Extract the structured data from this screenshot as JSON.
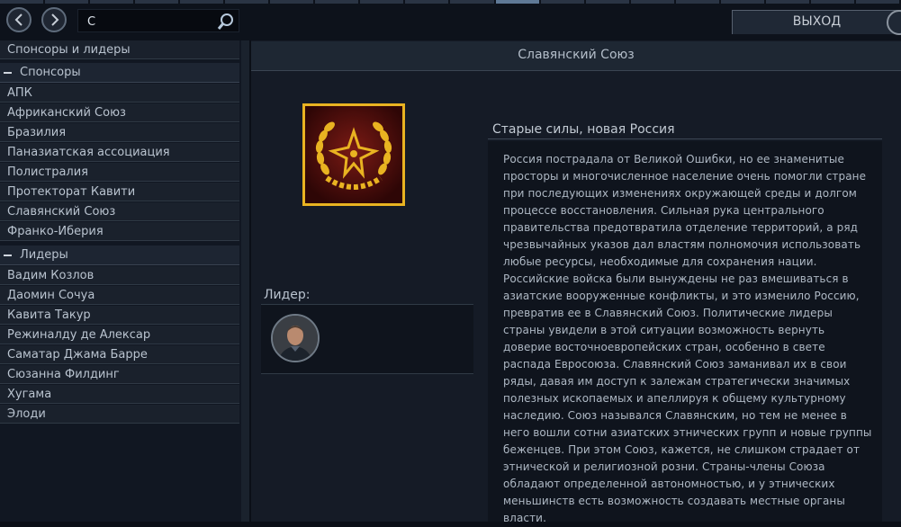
{
  "header": {
    "search": {
      "value": "С",
      "placeholder": ""
    },
    "exit_label": "ВЫХОД"
  },
  "sidebar": {
    "top_item": "Спонсоры и лидеры",
    "sponsors_header": "Спонсоры",
    "sponsors": [
      "АПК",
      "Африканский Союз",
      "Бразилия",
      "Паназиатская ассоциация",
      "Полистралия",
      "Протекторат Кавити",
      "Славянский Союз",
      "Франко-Иберия"
    ],
    "leaders_header": "Лидеры",
    "leaders": [
      "Вадим Козлов",
      "Даомин Сочуа",
      "Кавита Такур",
      "Режиналду де Алексар",
      "Саматар Джама Барре",
      "Сюзанна Филдинг",
      "Хугама",
      "Элоди"
    ]
  },
  "main": {
    "title": "Славянский Союз",
    "leader_label": "Лидер:",
    "desc_title": "Старые силы, новая Россия",
    "desc_body": "Россия пострадала от Великой Ошибки, но ее знаменитые просторы и многочисленное население очень помогли стране при последующих изменениях окружающей среды и долгом процессе восстановления. Сильная рука центрального правительства предотвратила отделение территорий, а ряд чрезвычайных указов дал властям полномочия использовать любые ресурсы, необходимые для сохранения нации. Российские войска были вынуждены не раз вмешиваться в азиатские вооруженные конфликты, и это изменило Россию, превратив ее в Славянский Союз. Политические лидеры страны увидели в этой ситуации возможность вернуть доверие восточноевропейских стран, особенно в свете распада Евросоюза. Славянский Союз заманивал их в свои ряды, давая им доступ к залежам стратегически значимых полезных ископаемых и апеллируя к общему культурному наследию. Союз назывался Славянским, но тем не менее в него вошли сотни азиатских этнических групп и новые группы беженцев. При этом Союз, кажется, не слишком страдает от этнической и религиозной розни. Страны-члены Союза обладают определенной автономностью, и у этнических меньшинств есть возможность создавать местные органы власти."
  },
  "colors": {
    "emblem_gold": "#e9b321",
    "emblem_bg": "#4a0e0e"
  },
  "icons": [
    "back-arrow-icon",
    "forward-arrow-icon",
    "search-icon",
    "minus-icon",
    "slavic-union-emblem"
  ]
}
